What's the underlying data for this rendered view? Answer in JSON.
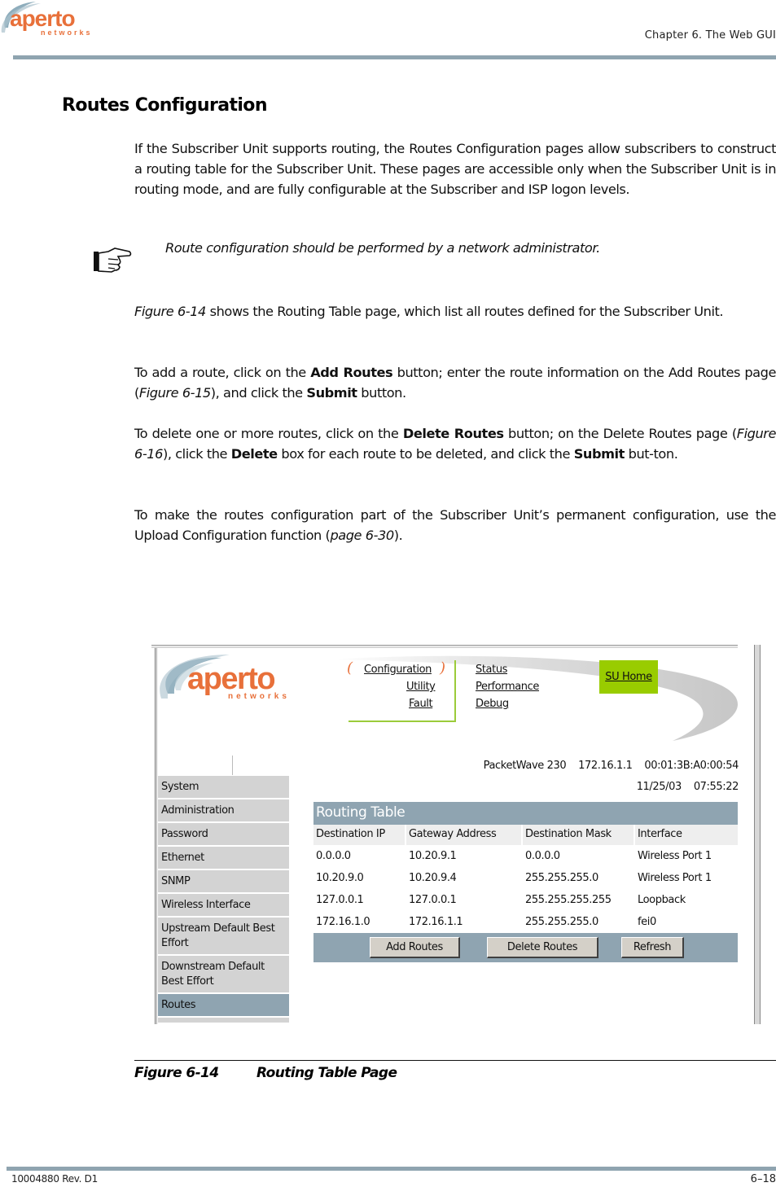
{
  "header": {
    "logo_text": "aperto",
    "logo_subtext": "networks",
    "chapter": "Chapter 6.  The Web GUI"
  },
  "section": {
    "title": "Routes Configuration",
    "p1": "If the Subscriber Unit supports routing, the Routes Configuration pages allow subscribers to construct a routing table for the Subscriber Unit. These pages are accessible only when the Subscriber Unit is in routing mode, and are fully configurable at the Subscriber and ISP logon levels.",
    "note": "Route configuration should be performed by a network administrator.",
    "p2": {
      "fig_ref": "Figure 6-14",
      "text": " shows the Routing Table page, which list all routes defined for the Subscriber Unit."
    },
    "p3": {
      "t1": "To add a route, click on the ",
      "b1": "Add Routes",
      "t2": " button; enter the route information on the Add Routes page (",
      "fig_ref": "Figure 6-15",
      "t3": "), and click the ",
      "b2": "Submit",
      "t4": " button."
    },
    "p4": {
      "t1": "To delete one or more routes, click on the ",
      "b1": "Delete Routes",
      "t2": " button; on the Delete Routes page (",
      "fig_ref": "Figure 6-16",
      "t3": "), click the ",
      "b2": "Delete",
      "t4": " box for each route to be deleted, and click the ",
      "b3": "Submit",
      "t5": " but-ton."
    },
    "p5": {
      "t1": "To make the routes configuration part of the Subscriber Unit’s permanent configuration, use the Upload Configuration function (",
      "page_ref": "page 6-30",
      "t2": ")."
    }
  },
  "screenshot": {
    "logo_text": "aperto",
    "logo_subtext": "networks",
    "nav_left": [
      "Configuration",
      "Utility",
      "Fault"
    ],
    "nav_right": [
      "Status",
      "Performance",
      "Debug"
    ],
    "su_home": "SU Home",
    "device": {
      "model": "PacketWave 230",
      "ip": "172.16.1.1",
      "mac": "00:01:3B:A0:00:54",
      "date": "11/25/03",
      "time": "07:55:22"
    },
    "sidebar": [
      {
        "label": "System"
      },
      {
        "label": "Administration"
      },
      {
        "label": "Password"
      },
      {
        "label": "Ethernet"
      },
      {
        "label": "SNMP"
      },
      {
        "label": "Wireless Interface"
      },
      {
        "label": "Upstream Default Best Effort"
      },
      {
        "label": "Downstream Default Best Effort"
      },
      {
        "label": "Routes",
        "active": true
      }
    ],
    "routing_table": {
      "title": "Routing Table",
      "columns": [
        "Destination IP",
        "Gateway Address",
        "Destination Mask",
        "Interface"
      ],
      "rows": [
        [
          "0.0.0.0",
          "10.20.9.1",
          "0.0.0.0",
          "Wireless Port 1"
        ],
        [
          "10.20.9.0",
          "10.20.9.4",
          "255.255.255.0",
          "Wireless Port 1"
        ],
        [
          "127.0.0.1",
          "127.0.0.1",
          "255.255.255.255",
          "Loopback"
        ],
        [
          "172.16.1.0",
          "172.16.1.1",
          "255.255.255.0",
          "fei0"
        ]
      ],
      "buttons": {
        "add": "Add Routes",
        "delete": "Delete Routes",
        "refresh": "Refresh"
      }
    },
    "colors": {
      "accent_blue_gray": "#8fa4b1",
      "su_home_green": "#99cc00",
      "logo_orange": "#e8703a",
      "logo_blue": "#7a9fb0"
    }
  },
  "figure": {
    "number": "Figure 6-14",
    "title": "Routing Table Page"
  },
  "footer": {
    "doc_id": "10004880 Rev. D1",
    "page": "6–18"
  }
}
